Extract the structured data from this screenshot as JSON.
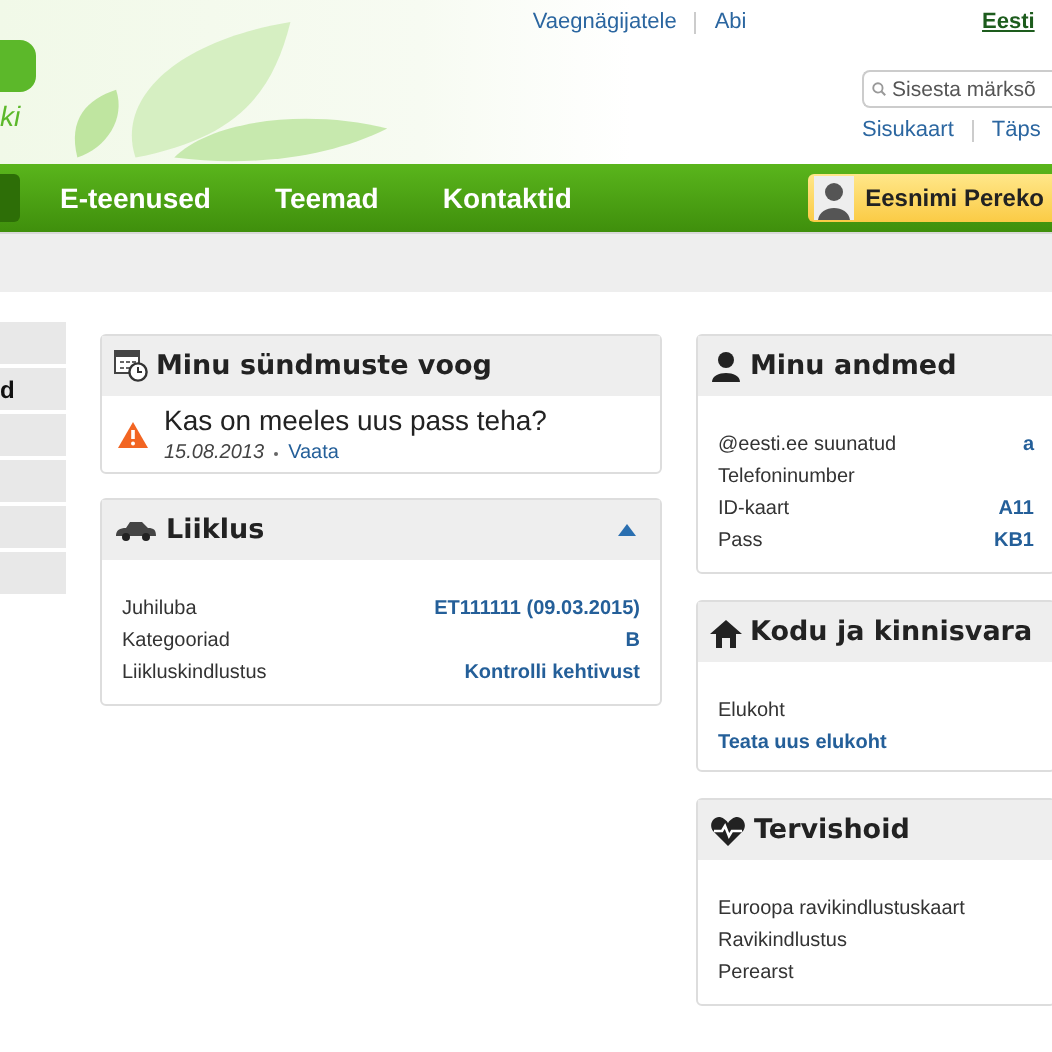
{
  "header": {
    "logo_text": "ki",
    "top_links": [
      "Vaegnägijatele",
      "Abi"
    ],
    "language_link": "Eesti",
    "search": {
      "placeholder": "Sisesta märksõ"
    },
    "utility_links": [
      "Sisukaart",
      "Täps"
    ]
  },
  "nav": {
    "items": [
      {
        "label": "E-teenused",
        "selected": false
      },
      {
        "label": "Teemad",
        "selected": false
      },
      {
        "label": "Kontaktid",
        "selected": false
      }
    ],
    "user": {
      "name": "Eesnimi Pereko"
    }
  },
  "sidebar": {
    "items": [
      {
        "label": "d",
        "selected": true
      }
    ]
  },
  "left_column": [
    {
      "kind": "events",
      "title": "Minu sündmuste voog",
      "events": [
        {
          "kind": "warning",
          "text": "Kas on meeles uus pass teha?",
          "date": "15.08.2013",
          "link": "Vaata"
        }
      ]
    },
    {
      "kind": "traffic",
      "title": "Liiklus",
      "expanded": true,
      "rows": [
        {
          "label": "Juhiluba",
          "value": "ET111111 (09.03.2015)"
        },
        {
          "label": "Kategooriad",
          "value": "B"
        },
        {
          "label": "Liikluskindlustus",
          "value": "Kontrolli kehtivust"
        }
      ]
    }
  ],
  "right_column": [
    {
      "kind": "profile",
      "title": "Minu andmed",
      "rows": [
        {
          "label": "@eesti.ee suunatud",
          "value": "a"
        },
        {
          "label": "Telefoninumber"
        },
        {
          "label": "ID-kaart",
          "value": "A11"
        },
        {
          "label": "Pass",
          "value": "KB1"
        }
      ]
    },
    {
      "kind": "home",
      "title": "Kodu ja kinnisvara",
      "rows": [
        {
          "label": "Elukoht"
        }
      ],
      "links": [
        "Teata uus elukoht"
      ]
    },
    {
      "kind": "health",
      "title": "Tervishoid",
      "rows": [
        {
          "label": "Euroopa ravikindlustuskaart"
        },
        {
          "label": "Ravikindlustus"
        },
        {
          "label": "Perearst"
        }
      ]
    }
  ]
}
